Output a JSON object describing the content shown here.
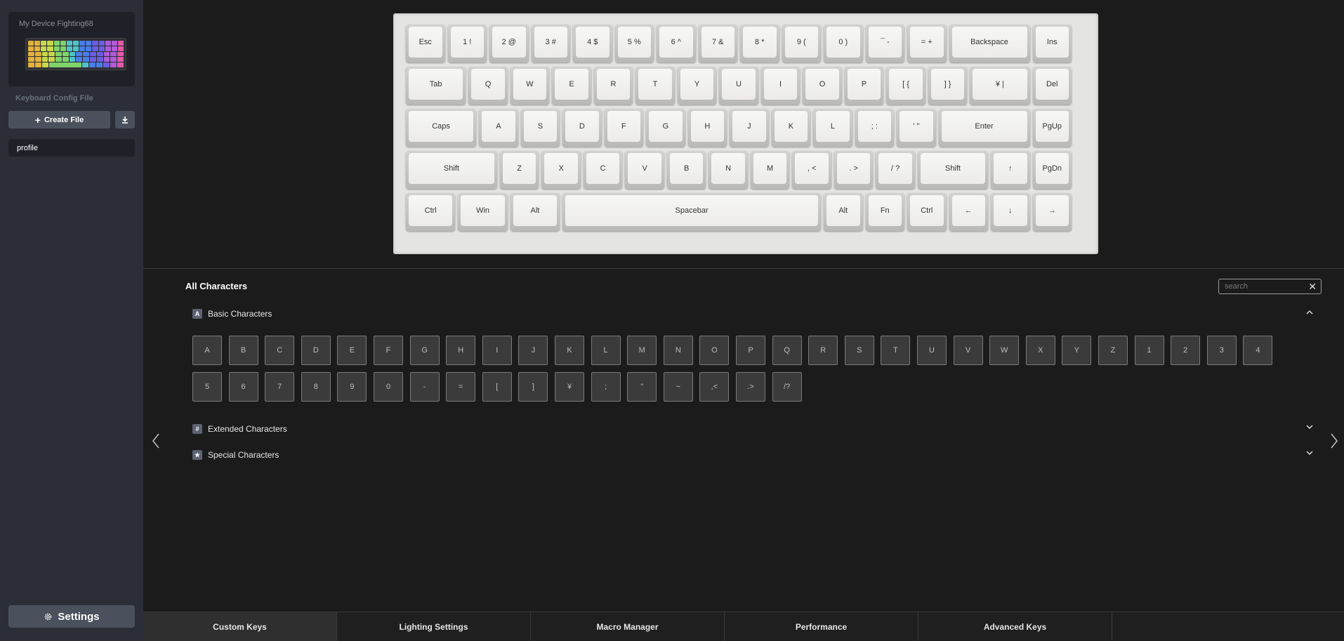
{
  "sidebar": {
    "device_name": "My Device Fighting68",
    "section_label": "Keyboard Config File",
    "create_file_label": "Create File",
    "profiles": [
      "profile"
    ],
    "settings_label": "Settings"
  },
  "keyboard": {
    "rows": [
      [
        {
          "label": "Esc",
          "w": 1
        },
        {
          "label": "1 !",
          "w": 1
        },
        {
          "label": "2 @",
          "w": 1
        },
        {
          "label": "3 #",
          "w": 1
        },
        {
          "label": "4 $",
          "w": 1
        },
        {
          "label": "5 %",
          "w": 1
        },
        {
          "label": "6 ^",
          "w": 1
        },
        {
          "label": "7 &",
          "w": 1
        },
        {
          "label": "8 *",
          "w": 1
        },
        {
          "label": "9 (",
          "w": 1
        },
        {
          "label": "0 )",
          "w": 1
        },
        {
          "label": "¯ -",
          "w": 1
        },
        {
          "label": "= +",
          "w": 1
        },
        {
          "label": "Backspace",
          "w": 2
        },
        {
          "label": "Ins",
          "w": 1
        }
      ],
      [
        {
          "label": "Tab",
          "w": 1.5
        },
        {
          "label": "Q",
          "w": 1
        },
        {
          "label": "W",
          "w": 1
        },
        {
          "label": "E",
          "w": 1
        },
        {
          "label": "R",
          "w": 1
        },
        {
          "label": "T",
          "w": 1
        },
        {
          "label": "Y",
          "w": 1
        },
        {
          "label": "U",
          "w": 1
        },
        {
          "label": "I",
          "w": 1
        },
        {
          "label": "O",
          "w": 1
        },
        {
          "label": "P",
          "w": 1
        },
        {
          "label": "[ {",
          "w": 1
        },
        {
          "label": "] }",
          "w": 1
        },
        {
          "label": "¥ |",
          "w": 1.5
        },
        {
          "label": "Del",
          "w": 1
        }
      ],
      [
        {
          "label": "Caps",
          "w": 1.75
        },
        {
          "label": "A",
          "w": 1
        },
        {
          "label": "S",
          "w": 1
        },
        {
          "label": "D",
          "w": 1
        },
        {
          "label": "F",
          "w": 1
        },
        {
          "label": "G",
          "w": 1
        },
        {
          "label": "H",
          "w": 1
        },
        {
          "label": "J",
          "w": 1
        },
        {
          "label": "K",
          "w": 1
        },
        {
          "label": "L",
          "w": 1
        },
        {
          "label": "; :",
          "w": 1
        },
        {
          "label": "' \"",
          "w": 1
        },
        {
          "label": "Enter",
          "w": 2.25
        },
        {
          "label": "PgUp",
          "w": 1
        }
      ],
      [
        {
          "label": "Shift",
          "w": 2.25
        },
        {
          "label": "Z",
          "w": 1
        },
        {
          "label": "X",
          "w": 1
        },
        {
          "label": "C",
          "w": 1
        },
        {
          "label": "V",
          "w": 1
        },
        {
          "label": "B",
          "w": 1
        },
        {
          "label": "N",
          "w": 1
        },
        {
          "label": "M",
          "w": 1
        },
        {
          "label": ", <",
          "w": 1
        },
        {
          "label": ". >",
          "w": 1
        },
        {
          "label": "/ ?",
          "w": 1
        },
        {
          "label": "Shift",
          "w": 1.75
        },
        {
          "label": "↑",
          "w": 1
        },
        {
          "label": "PgDn",
          "w": 1
        }
      ],
      [
        {
          "label": "Ctrl",
          "w": 1.25
        },
        {
          "label": "Win",
          "w": 1.25
        },
        {
          "label": "Alt",
          "w": 1.25
        },
        {
          "label": "Spacebar",
          "w": 6.25
        },
        {
          "label": "Alt",
          "w": 1
        },
        {
          "label": "Fn",
          "w": 1
        },
        {
          "label": "Ctrl",
          "w": 1
        },
        {
          "label": "←",
          "w": 1
        },
        {
          "label": "↓",
          "w": 1
        },
        {
          "label": "→",
          "w": 1
        }
      ]
    ]
  },
  "characters": {
    "title": "All Characters",
    "search_placeholder": "search",
    "categories": [
      {
        "icon": "A",
        "label": "Basic Characters",
        "expanded": true,
        "items": [
          "A",
          "B",
          "C",
          "D",
          "E",
          "F",
          "G",
          "H",
          "I",
          "J",
          "K",
          "L",
          "M",
          "N",
          "O",
          "P",
          "Q",
          "R",
          "S",
          "T",
          "U",
          "V",
          "W",
          "X",
          "Y",
          "Z",
          "1",
          "2",
          "3",
          "4",
          "5",
          "6",
          "7",
          "8",
          "9",
          "0",
          "-",
          "=",
          "[",
          "]",
          "¥",
          ";",
          "\"",
          "~",
          ",<",
          ".>",
          "/?"
        ]
      },
      {
        "icon": "#",
        "label": "Extended Characters",
        "expanded": false
      },
      {
        "icon": "★",
        "label": "Special Characters",
        "expanded": false
      }
    ]
  },
  "tabs": [
    {
      "label": "Custom Keys",
      "active": true
    },
    {
      "label": "Lighting Settings",
      "active": false
    },
    {
      "label": "Macro Manager",
      "active": false
    },
    {
      "label": "Performance",
      "active": false
    },
    {
      "label": "Advanced Keys",
      "active": false
    }
  ]
}
